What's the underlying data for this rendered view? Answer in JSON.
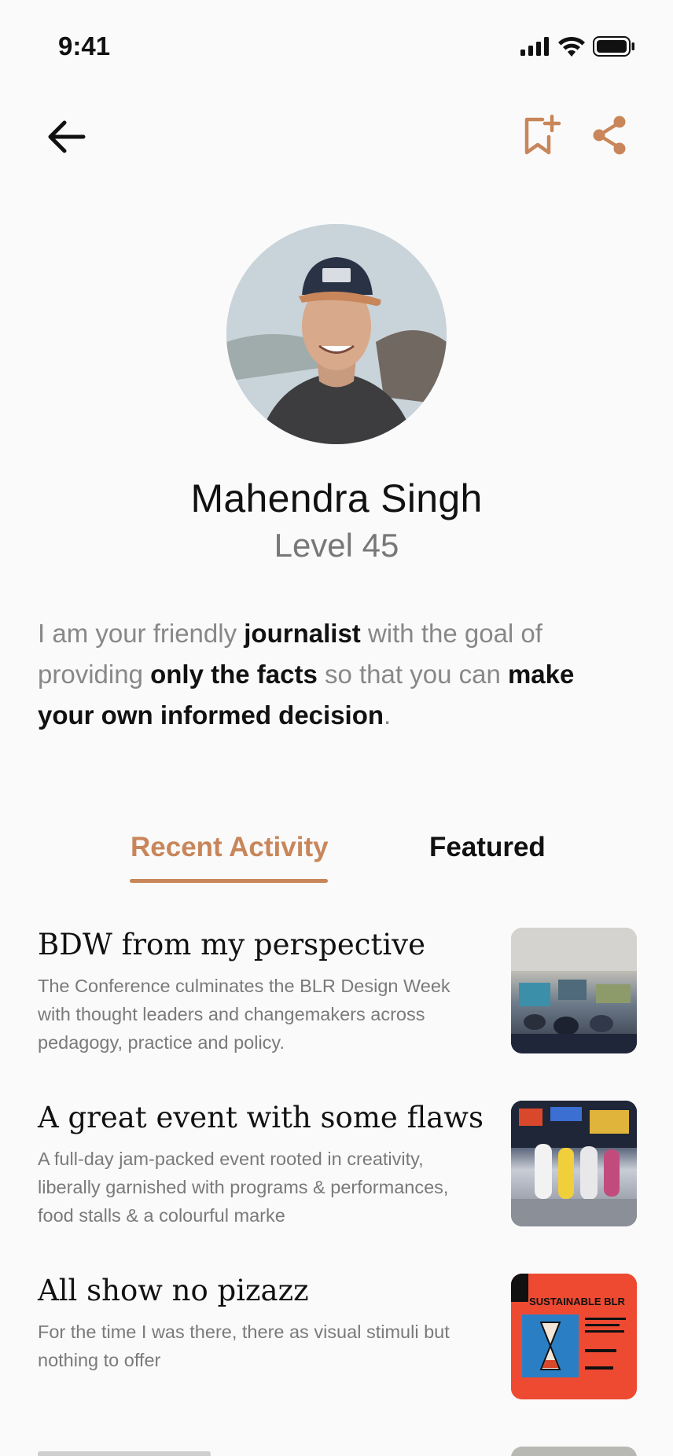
{
  "status_bar": {
    "time": "9:41"
  },
  "nav": {
    "back_icon": "arrow-left-icon",
    "bookmark_icon": "bookmark-add-icon",
    "share_icon": "share-icon"
  },
  "profile": {
    "name": "Mahendra Singh",
    "level": "Level 45",
    "bio": [
      {
        "text": "I am your friendly ",
        "bold": false
      },
      {
        "text": "journalist",
        "bold": true
      },
      {
        "text": " with the goal of providing ",
        "bold": false
      },
      {
        "text": "only the facts",
        "bold": true
      },
      {
        "text": " so that you can ",
        "bold": false
      },
      {
        "text": "make your own informed decision",
        "bold": true
      },
      {
        "text": ".",
        "bold": false
      }
    ]
  },
  "tabs": [
    {
      "label": "Recent Activity",
      "active": true
    },
    {
      "label": "Featured",
      "active": false
    }
  ],
  "articles": [
    {
      "title": "BDW from my perspective",
      "description": "The Conference culminates the BLR Design Week with thought leaders and changemakers across pedagogy, practice and policy."
    },
    {
      "title": "A great event with some flaws",
      "description": "A full-day jam-packed event rooted in creativity, liberally garnished with programs & performances, food stalls & a colourful marke"
    },
    {
      "title": "All show no pizazz",
      "description": "For the time I was there, there as visual stimuli but nothing to offer",
      "thumb_text": "SUSTAINABLE BLR"
    }
  ],
  "colors": {
    "accent": "#c8865a",
    "background": "#fafafa",
    "text": "#111111",
    "muted": "#7a7a7a"
  }
}
